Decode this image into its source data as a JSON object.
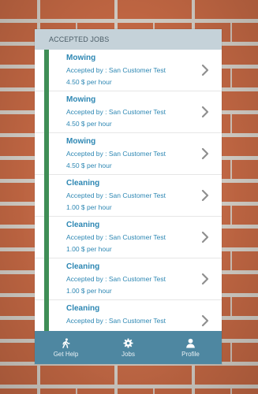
{
  "header": {
    "title": "ACCEPTED JOBS"
  },
  "jobs": [
    {
      "title": "Mowing",
      "accepted_by": "Accepted by : San Customer Test",
      "rate": "4.50 $ per hour"
    },
    {
      "title": "Mowing",
      "accepted_by": "Accepted by : San Customer Test",
      "rate": "4.50 $ per hour"
    },
    {
      "title": "Mowing",
      "accepted_by": "Accepted by : San Customer Test",
      "rate": "4.50 $ per hour"
    },
    {
      "title": "Cleaning",
      "accepted_by": "Accepted by : San Customer Test",
      "rate": "1.00 $ per hour"
    },
    {
      "title": "Cleaning",
      "accepted_by": "Accepted by : San Customer Test",
      "rate": "1.00 $ per hour"
    },
    {
      "title": "Cleaning",
      "accepted_by": "Accepted by : San Customer Test",
      "rate": "1.00 $ per hour"
    },
    {
      "title": "Cleaning",
      "accepted_by": "Accepted by : San Customer Test",
      "rate": ""
    }
  ],
  "tabs": [
    {
      "label": "Get Help",
      "icon": "walking-person-icon"
    },
    {
      "label": "Jobs",
      "icon": "gear-icon"
    },
    {
      "label": "Profile",
      "icon": "user-icon"
    }
  ],
  "colors": {
    "accent": "#2d87b3",
    "status_stripe": "#3f8e56",
    "tabbar": "#4e87a1",
    "header_bg": "#c5d2d9",
    "background_brick": "#c86a45"
  }
}
